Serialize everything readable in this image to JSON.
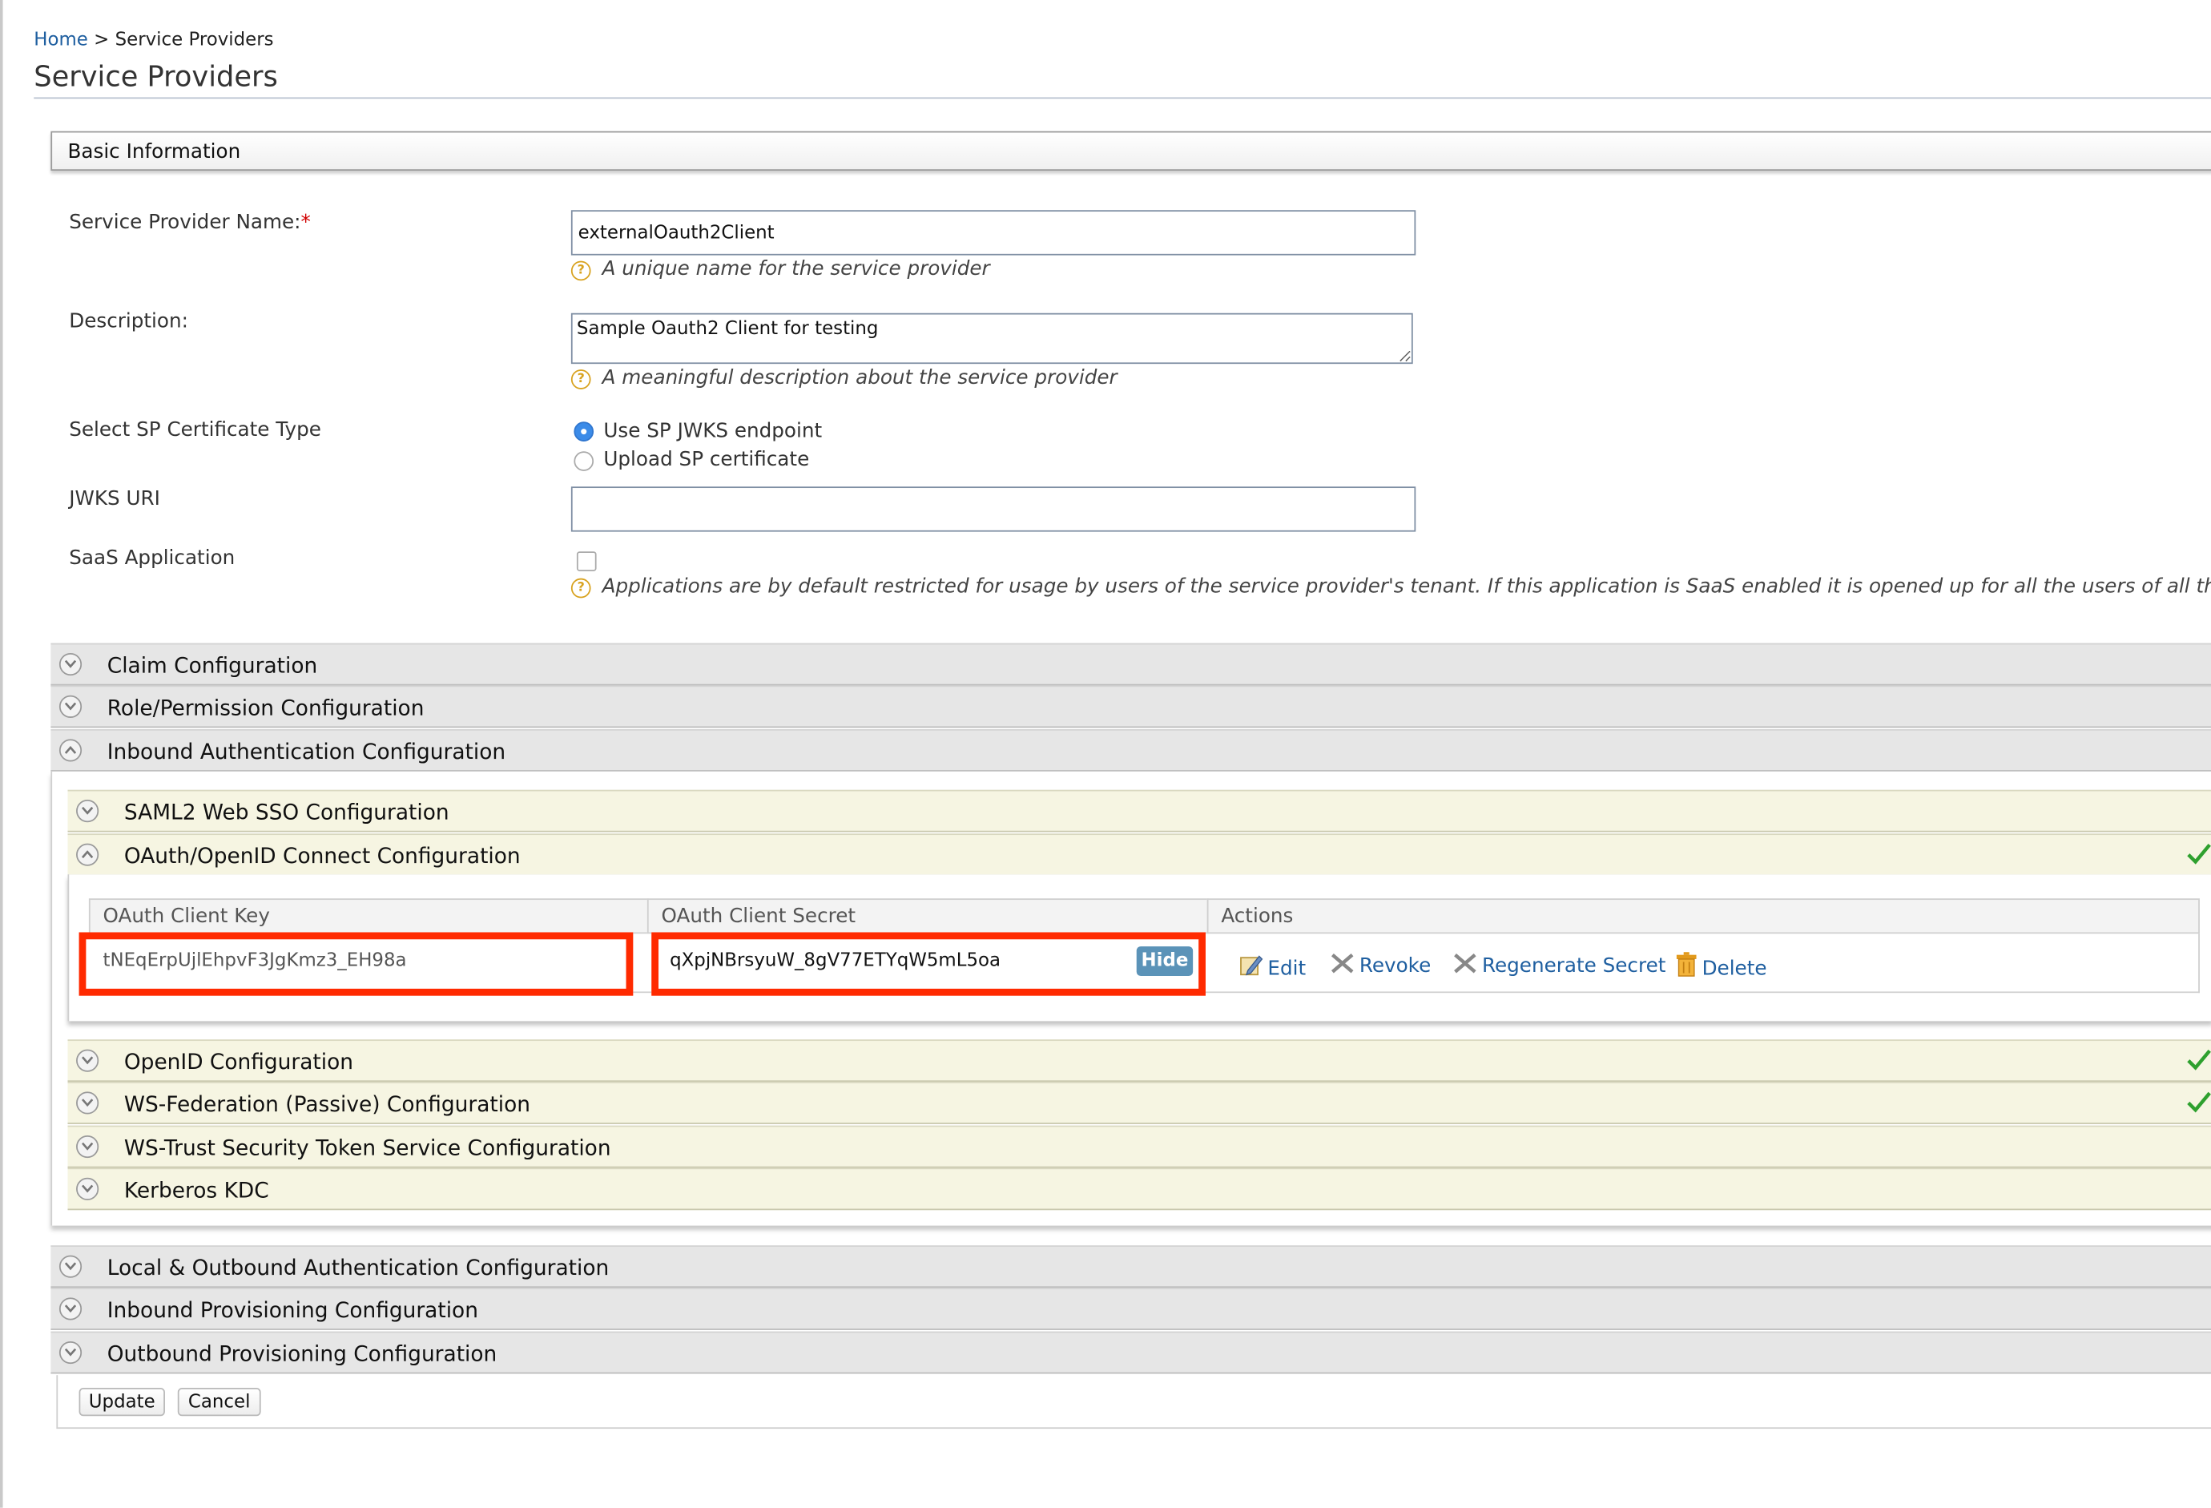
{
  "breadcrumb": {
    "home": "Home",
    "separator": ">",
    "current": "Service Providers"
  },
  "page_title": "Service Providers",
  "basic_info": {
    "header": "Basic Information",
    "sp_name_label": "Service Provider Name:",
    "required_mark": "*",
    "sp_name_value": "externalOauth2Client",
    "sp_name_hint": "A unique name for the service provider",
    "description_label": "Description:",
    "description_value": "Sample Oauth2 Client for testing",
    "description_hint": "A meaningful description about the service provider",
    "cert_type_label": "Select SP Certificate Type",
    "cert_options": [
      "Use SP JWKS endpoint",
      "Upload SP certificate"
    ],
    "cert_selected": "Use SP JWKS endpoint",
    "jwks_label": "JWKS URI",
    "jwks_value": "",
    "saas_label": "SaaS Application",
    "saas_checked": false,
    "saas_hint": "Applications are by default restricted for usage by users of the service provider's tenant. If this application is SaaS enabled it is opened up for all the users of all the tenants."
  },
  "sections": {
    "claim": "Claim Configuration",
    "role": "Role/Permission Configuration",
    "inbound_auth": "Inbound Authentication Configuration",
    "local_outbound": "Local & Outbound Authentication Configuration",
    "inbound_prov": "Inbound Provisioning Configuration",
    "outbound_prov": "Outbound Provisioning Configuration"
  },
  "inbound": {
    "saml": "SAML2 Web SSO Configuration",
    "oauth": "OAuth/OpenID Connect Configuration",
    "openid": "OpenID Configuration",
    "wsfed": "WS-Federation (Passive) Configuration",
    "wstrust": "WS-Trust Security Token Service Configuration",
    "kerberos": "Kerberos KDC"
  },
  "oauth_table": {
    "headers": [
      "OAuth Client Key",
      "OAuth Client Secret",
      "Actions"
    ],
    "client_key": "tNEqErpUjlEhpvF3JgKmz3_EH98a",
    "client_secret": "qXpjNBrsyuW_8gV77ETYqW5mL5oa",
    "hide_label": "Hide",
    "actions": [
      "Edit",
      "Revoke",
      "Regenerate Secret",
      "Delete"
    ]
  },
  "buttons": {
    "update": "Update",
    "cancel": "Cancel"
  },
  "colors": {
    "highlight_box": "#ff2a00",
    "link": "#1f5fa0",
    "check": "#2ea02e"
  },
  "icons": [
    "help-icon",
    "chevron-down-icon",
    "chevron-up-icon",
    "checkmark-icon",
    "edit-icon",
    "revoke-icon",
    "regenerate-icon",
    "trash-icon"
  ]
}
